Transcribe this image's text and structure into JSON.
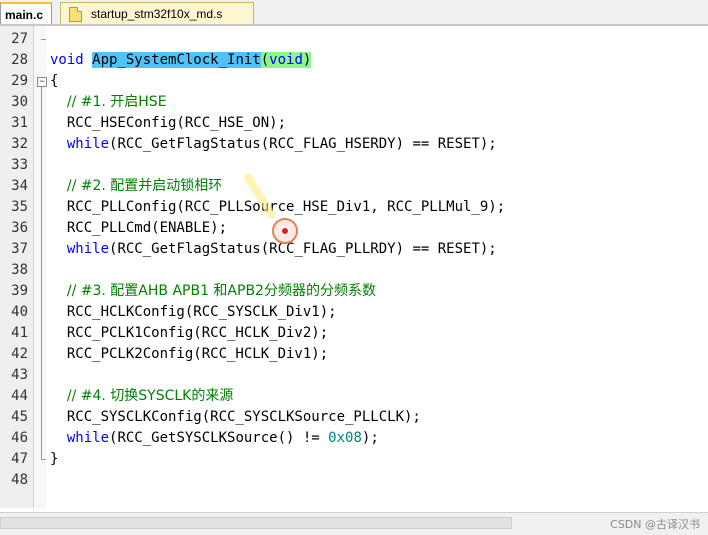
{
  "tabs": [
    {
      "label": "main.c",
      "active": true
    },
    {
      "label": "startup_stm32f10x_md.s",
      "active": false
    }
  ],
  "lines": [
    {
      "num": "27"
    },
    {
      "num": "28",
      "parts": [
        [
          "kw",
          "void"
        ],
        [
          "t",
          " "
        ],
        [
          "fn",
          "App_SystemClock_Init"
        ],
        [
          "pa",
          "("
        ],
        [
          "kwpa",
          "void"
        ],
        [
          "pa",
          ")"
        ]
      ]
    },
    {
      "num": "29",
      "parts": [
        [
          "t",
          "{"
        ]
      ]
    },
    {
      "num": "30",
      "parts": [
        [
          "t",
          "  "
        ],
        [
          "cm",
          "// #1. 开启HSE"
        ]
      ]
    },
    {
      "num": "31",
      "parts": [
        [
          "t",
          "  RCC_HSEConfig(RCC_HSE_ON);"
        ]
      ]
    },
    {
      "num": "32",
      "parts": [
        [
          "t",
          "  "
        ],
        [
          "kw",
          "while"
        ],
        [
          "t",
          "(RCC_GetFlagStatus(RCC_FLAG_HSERDY) == RESET);"
        ]
      ]
    },
    {
      "num": "33"
    },
    {
      "num": "34",
      "parts": [
        [
          "t",
          "  "
        ],
        [
          "cm",
          "// #2. 配置并启动锁相环"
        ]
      ]
    },
    {
      "num": "35",
      "parts": [
        [
          "t",
          "  RCC_PLLConfig(RCC_PLLSource_HSE_Div1, RCC_PLLMul_9);"
        ]
      ]
    },
    {
      "num": "36",
      "parts": [
        [
          "t",
          "  RCC_PLLCmd(ENABLE);"
        ]
      ]
    },
    {
      "num": "37",
      "parts": [
        [
          "t",
          "  "
        ],
        [
          "kw",
          "while"
        ],
        [
          "t",
          "(RCC_GetFlagStatus(RCC_FLAG_PLLRDY) == RESET);"
        ]
      ]
    },
    {
      "num": "38"
    },
    {
      "num": "39",
      "parts": [
        [
          "t",
          "  "
        ],
        [
          "cm",
          "// #3. 配置AHB APB1 和APB2分频器的分频系数"
        ]
      ]
    },
    {
      "num": "40",
      "parts": [
        [
          "t",
          "  RCC_HCLKConfig(RCC_SYSCLK_Div1);"
        ]
      ]
    },
    {
      "num": "41",
      "parts": [
        [
          "t",
          "  RCC_PCLK1Config(RCC_HCLK_Div2);"
        ]
      ]
    },
    {
      "num": "42",
      "parts": [
        [
          "t",
          "  RCC_PCLK2Config(RCC_HCLK_Div1);"
        ]
      ]
    },
    {
      "num": "43"
    },
    {
      "num": "44",
      "parts": [
        [
          "t",
          "  "
        ],
        [
          "cm",
          "// #4. 切换SYSCLK的来源"
        ]
      ]
    },
    {
      "num": "45",
      "parts": [
        [
          "t",
          "  RCC_SYSCLKConfig(RCC_SYSCLKSource_PLLCLK);"
        ]
      ]
    },
    {
      "num": "46",
      "parts": [
        [
          "t",
          "  "
        ],
        [
          "kw",
          "while"
        ],
        [
          "t",
          "(RCC_GetSYSCLKSource() != "
        ],
        [
          "num",
          "0x08"
        ],
        [
          "t",
          ");"
        ]
      ]
    },
    {
      "num": "47",
      "parts": [
        [
          "t",
          "}"
        ]
      ]
    },
    {
      "num": "48"
    }
  ],
  "watermark": "CSDN @古译汉书",
  "colors": {
    "keyword": "#0000ff",
    "comment": "#008000",
    "number": "#008080",
    "function_highlight": "#4fc3f7",
    "paren_highlight": "#8cf58c"
  }
}
